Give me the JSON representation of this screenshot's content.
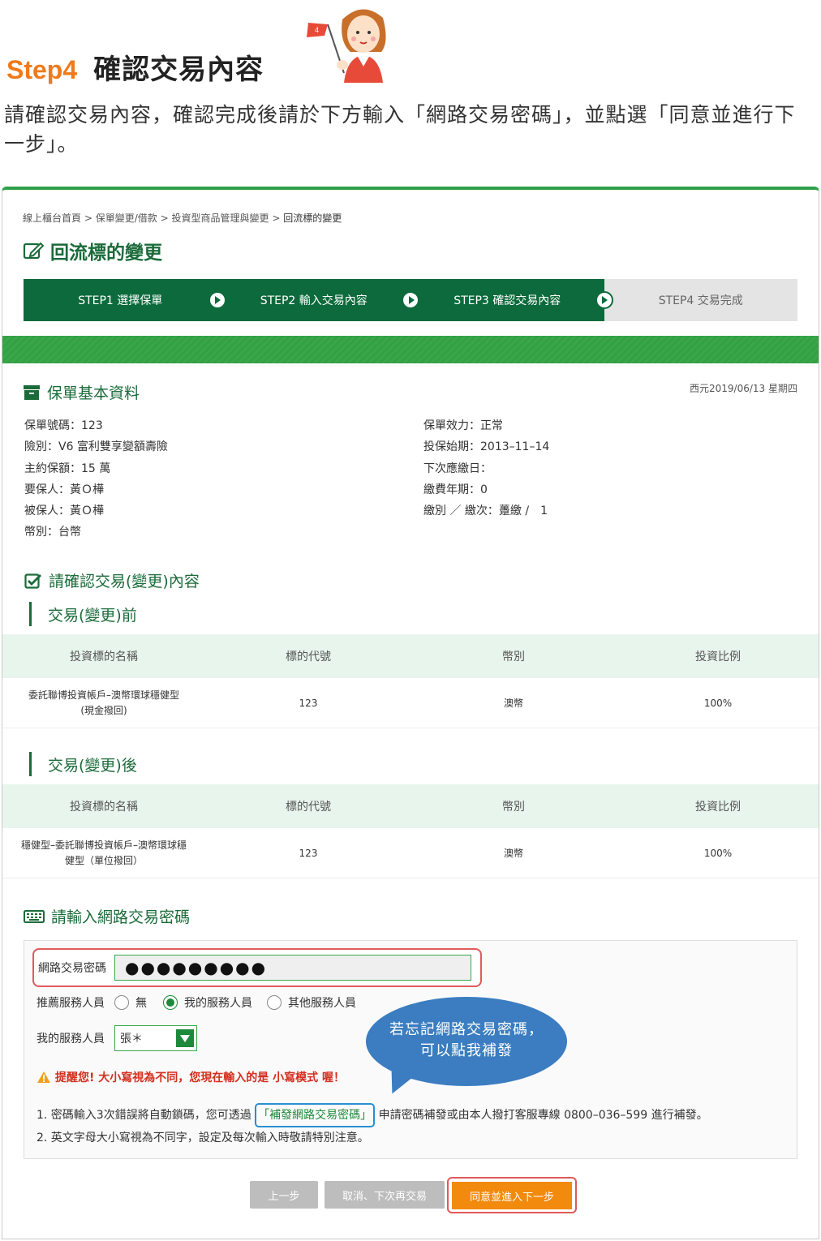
{
  "guide": {
    "step": "Step4",
    "heading": "確認交易內容",
    "mascot_flag": "4",
    "description": "請確認交易內容，確認完成後請於下方輸入「網路交易密碼」，並點選「同意並進行下一步」。"
  },
  "breadcrumb": {
    "items": [
      "線上櫃台首頁",
      "保單變更/借款",
      "投資型商品管理與變更"
    ],
    "current": "回流標的變更",
    "separator": ">"
  },
  "page_title": "回流標的變更",
  "steps": [
    {
      "label": "STEP1 選擇保單",
      "active": true
    },
    {
      "label": "STEP2 輸入交易內容",
      "active": true
    },
    {
      "label": "STEP3 確認交易內容",
      "active": true
    },
    {
      "label": "STEP4 交易完成",
      "active": false
    }
  ],
  "policy": {
    "section_title": "保單基本資料",
    "date": "西元2019/06/13 星期四",
    "left": [
      "保單號碼：123",
      "險別：V6 富利雙享變額壽險",
      "主約保額：15 萬",
      "要保人：黃Ｏ樺",
      "被保人：黃Ｏ樺",
      "幣別：台幣"
    ],
    "right": [
      "保單效力：正常",
      "投保始期：2013–11–14",
      "下次應繳日：",
      "繳費年期：0",
      "繳別 ／ 繳次：躉繳 /　1"
    ]
  },
  "confirm": {
    "section_title": "請確認交易(變更)內容",
    "before_title": "交易(變更)前",
    "after_title": "交易(變更)後",
    "columns": [
      "投資標的名稱",
      "標的代號",
      "幣別",
      "投資比例"
    ],
    "before_rows": [
      {
        "name1": "委託聯博投資帳戶–澳幣環球穩健型",
        "name2": "(現金撥回)",
        "code": "123",
        "currency": "澳幣",
        "ratio": "100%"
      }
    ],
    "after_rows": [
      {
        "name1": "穩健型–委託聯博投資帳戶–澳幣環球穩",
        "name2": "健型（單位撥回）",
        "code": "123",
        "currency": "澳幣",
        "ratio": "100%"
      }
    ]
  },
  "password": {
    "section_title": "請輸入網路交易密碼",
    "label": "網路交易密碼",
    "value": "●●●●●●●●●",
    "recommend_label": "推薦服務人員",
    "options": [
      "無",
      "我的服務人員",
      "其他服務人員"
    ],
    "selected_option": 1,
    "sales_label": "我的服務人員",
    "sales_value": "張＊",
    "warning": "提醒您! 大小寫視為不同，您現在輸入的是 小寫模式 喔！",
    "note1_prefix": "1. 密碼輸入3次錯誤將自動鎖碼，您可透過",
    "note1_link": "「補發網路交易密碼」",
    "note1_suffix": "申請密碼補發或由本人撥打客服專線 0800–036–599 進行補發。",
    "note2": "2. 英文字母大小寫視為不同字，設定及每次輸入時敬請特別注意。"
  },
  "bubble": {
    "line1": "若忘記網路交易密碼，",
    "line2": "可以點我補發"
  },
  "buttons": {
    "prev": "上一步",
    "cancel": "取消、下次再交易",
    "agree": "同意並進入下一步"
  },
  "colors": {
    "brand_green": "#0c6a3c",
    "accent_orange": "#f28a0d",
    "highlight_red": "#e05a5a",
    "bubble_blue": "#3b7dc0"
  }
}
